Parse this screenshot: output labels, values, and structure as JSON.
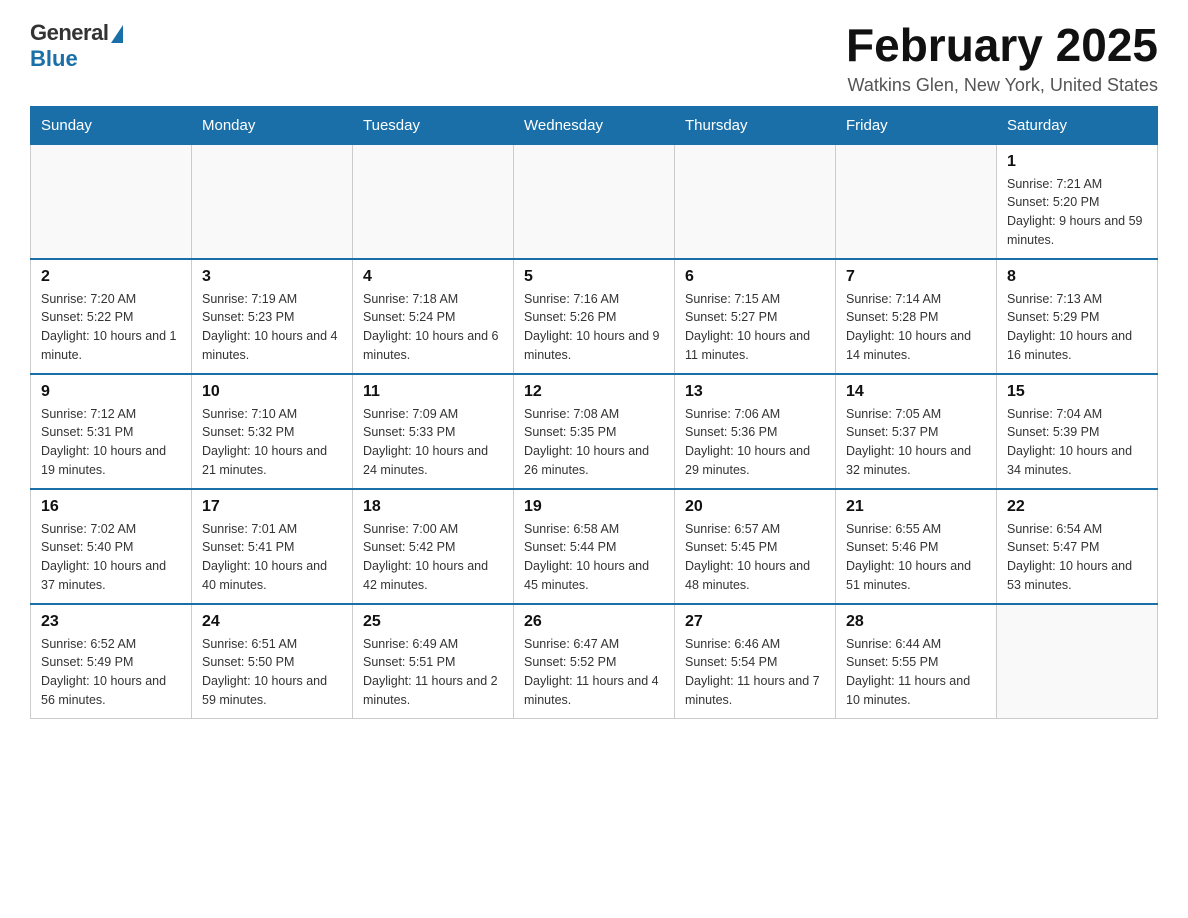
{
  "logo": {
    "general": "General",
    "blue": "Blue"
  },
  "title": "February 2025",
  "location": "Watkins Glen, New York, United States",
  "days_of_week": [
    "Sunday",
    "Monday",
    "Tuesday",
    "Wednesday",
    "Thursday",
    "Friday",
    "Saturday"
  ],
  "weeks": [
    [
      {
        "day": "",
        "info": ""
      },
      {
        "day": "",
        "info": ""
      },
      {
        "day": "",
        "info": ""
      },
      {
        "day": "",
        "info": ""
      },
      {
        "day": "",
        "info": ""
      },
      {
        "day": "",
        "info": ""
      },
      {
        "day": "1",
        "info": "Sunrise: 7:21 AM\nSunset: 5:20 PM\nDaylight: 9 hours and 59 minutes."
      }
    ],
    [
      {
        "day": "2",
        "info": "Sunrise: 7:20 AM\nSunset: 5:22 PM\nDaylight: 10 hours and 1 minute."
      },
      {
        "day": "3",
        "info": "Sunrise: 7:19 AM\nSunset: 5:23 PM\nDaylight: 10 hours and 4 minutes."
      },
      {
        "day": "4",
        "info": "Sunrise: 7:18 AM\nSunset: 5:24 PM\nDaylight: 10 hours and 6 minutes."
      },
      {
        "day": "5",
        "info": "Sunrise: 7:16 AM\nSunset: 5:26 PM\nDaylight: 10 hours and 9 minutes."
      },
      {
        "day": "6",
        "info": "Sunrise: 7:15 AM\nSunset: 5:27 PM\nDaylight: 10 hours and 11 minutes."
      },
      {
        "day": "7",
        "info": "Sunrise: 7:14 AM\nSunset: 5:28 PM\nDaylight: 10 hours and 14 minutes."
      },
      {
        "day": "8",
        "info": "Sunrise: 7:13 AM\nSunset: 5:29 PM\nDaylight: 10 hours and 16 minutes."
      }
    ],
    [
      {
        "day": "9",
        "info": "Sunrise: 7:12 AM\nSunset: 5:31 PM\nDaylight: 10 hours and 19 minutes."
      },
      {
        "day": "10",
        "info": "Sunrise: 7:10 AM\nSunset: 5:32 PM\nDaylight: 10 hours and 21 minutes."
      },
      {
        "day": "11",
        "info": "Sunrise: 7:09 AM\nSunset: 5:33 PM\nDaylight: 10 hours and 24 minutes."
      },
      {
        "day": "12",
        "info": "Sunrise: 7:08 AM\nSunset: 5:35 PM\nDaylight: 10 hours and 26 minutes."
      },
      {
        "day": "13",
        "info": "Sunrise: 7:06 AM\nSunset: 5:36 PM\nDaylight: 10 hours and 29 minutes."
      },
      {
        "day": "14",
        "info": "Sunrise: 7:05 AM\nSunset: 5:37 PM\nDaylight: 10 hours and 32 minutes."
      },
      {
        "day": "15",
        "info": "Sunrise: 7:04 AM\nSunset: 5:39 PM\nDaylight: 10 hours and 34 minutes."
      }
    ],
    [
      {
        "day": "16",
        "info": "Sunrise: 7:02 AM\nSunset: 5:40 PM\nDaylight: 10 hours and 37 minutes."
      },
      {
        "day": "17",
        "info": "Sunrise: 7:01 AM\nSunset: 5:41 PM\nDaylight: 10 hours and 40 minutes."
      },
      {
        "day": "18",
        "info": "Sunrise: 7:00 AM\nSunset: 5:42 PM\nDaylight: 10 hours and 42 minutes."
      },
      {
        "day": "19",
        "info": "Sunrise: 6:58 AM\nSunset: 5:44 PM\nDaylight: 10 hours and 45 minutes."
      },
      {
        "day": "20",
        "info": "Sunrise: 6:57 AM\nSunset: 5:45 PM\nDaylight: 10 hours and 48 minutes."
      },
      {
        "day": "21",
        "info": "Sunrise: 6:55 AM\nSunset: 5:46 PM\nDaylight: 10 hours and 51 minutes."
      },
      {
        "day": "22",
        "info": "Sunrise: 6:54 AM\nSunset: 5:47 PM\nDaylight: 10 hours and 53 minutes."
      }
    ],
    [
      {
        "day": "23",
        "info": "Sunrise: 6:52 AM\nSunset: 5:49 PM\nDaylight: 10 hours and 56 minutes."
      },
      {
        "day": "24",
        "info": "Sunrise: 6:51 AM\nSunset: 5:50 PM\nDaylight: 10 hours and 59 minutes."
      },
      {
        "day": "25",
        "info": "Sunrise: 6:49 AM\nSunset: 5:51 PM\nDaylight: 11 hours and 2 minutes."
      },
      {
        "day": "26",
        "info": "Sunrise: 6:47 AM\nSunset: 5:52 PM\nDaylight: 11 hours and 4 minutes."
      },
      {
        "day": "27",
        "info": "Sunrise: 6:46 AM\nSunset: 5:54 PM\nDaylight: 11 hours and 7 minutes."
      },
      {
        "day": "28",
        "info": "Sunrise: 6:44 AM\nSunset: 5:55 PM\nDaylight: 11 hours and 10 minutes."
      },
      {
        "day": "",
        "info": ""
      }
    ]
  ]
}
